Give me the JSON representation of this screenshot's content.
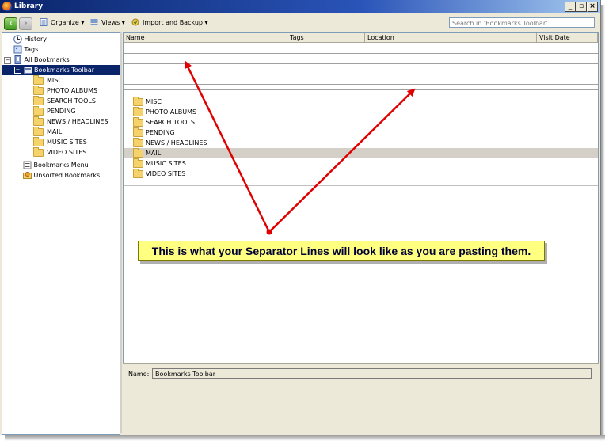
{
  "window": {
    "title": "Library"
  },
  "toolbar": {
    "organize": "Organize",
    "views": "Views",
    "import_backup": "Import and Backup",
    "search_placeholder": "Search in 'Bookmarks Toolbar'"
  },
  "sidebar": {
    "history": "History",
    "tags": "Tags",
    "all_bookmarks": "All Bookmarks",
    "bookmarks_toolbar": "Bookmarks Toolbar",
    "folders": [
      "MISC",
      "PHOTO ALBUMS",
      "SEARCH TOOLS",
      "PENDING",
      "NEWS / HEADLINES",
      "MAIL",
      "MUSIC SITES",
      "VIDEO SITES"
    ],
    "bookmarks_menu": "Bookmarks Menu",
    "unsorted": "Unsorted Bookmarks"
  },
  "table": {
    "columns": [
      "Name",
      "Tags",
      "Location",
      "Visit Date"
    ],
    "items": [
      "MISC",
      "PHOTO ALBUMS",
      "SEARCH TOOLS",
      "PENDING",
      "NEWS / HEADLINES",
      "MAIL",
      "MUSIC SITES",
      "VIDEO SITES"
    ]
  },
  "detail": {
    "name_label": "Name:",
    "name_value": "Bookmarks Toolbar"
  },
  "annotation": {
    "text": "This is what your Separator Lines will look like as you are pasting them."
  },
  "colors": {
    "arrow": "#e00000",
    "callout_bg": "#ffff80",
    "selection": "#0a246a"
  }
}
